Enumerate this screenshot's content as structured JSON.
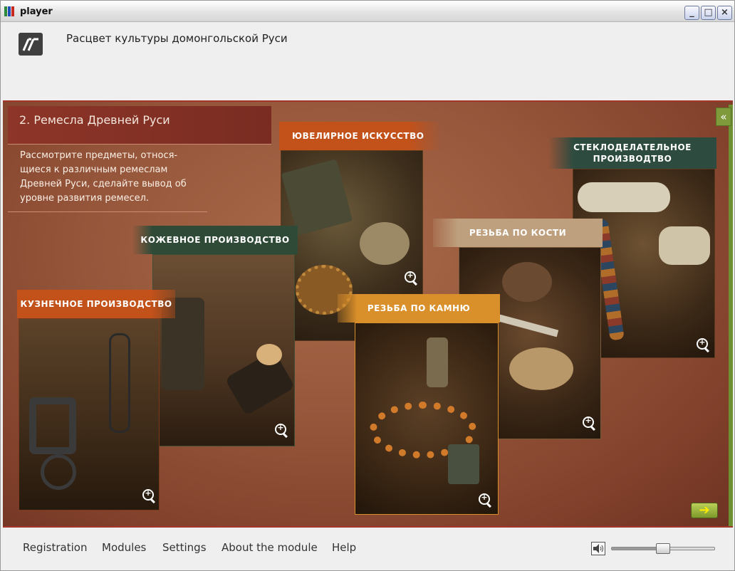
{
  "window": {
    "title": "player",
    "minimize_icon": "minimize-icon",
    "maximize_icon": "maximize-icon",
    "close_icon": "close-icon"
  },
  "header": {
    "logo_icon": "module-logo-icon",
    "course_title": "Расцвет культуры домонгольской Руси"
  },
  "lesson": {
    "section_title": "2. Ремесла Древней Руси",
    "instruction": "Рассмотрите предметы, относя-щиеся к различным ремеслам Древней Руси, сделайте вывод об уровне развития ремесел.",
    "collapse_label": "«",
    "next_label": "➔",
    "cards": [
      {
        "label": "ЮВЕЛИРНОЕ ИСКУССТВО",
        "color": "#c2511a"
      },
      {
        "label": "СТЕКЛОДЕЛАТЕЛЬНОЕ ПРОИЗВОДТВО",
        "color": "#2d4b3f"
      },
      {
        "label": "КОЖЕВНОЕ ПРОИЗВОДСТВО",
        "color": "#2f4b38"
      },
      {
        "label": "РЕЗЬБА ПО КОСТИ",
        "color": "#bfa07e"
      },
      {
        "label": "КУЗНЕЧНОЕ ПРОИЗВОДСТВО",
        "color": "#c2511a"
      },
      {
        "label": "РЕЗЬБА ПО КАМНЮ",
        "color": "#d98f2a"
      }
    ]
  },
  "footer": {
    "menu": [
      "Registration",
      "Modules",
      "Settings",
      "About the module",
      "Help"
    ],
    "volume_icon": "speaker-icon",
    "volume_level": 0.5
  }
}
